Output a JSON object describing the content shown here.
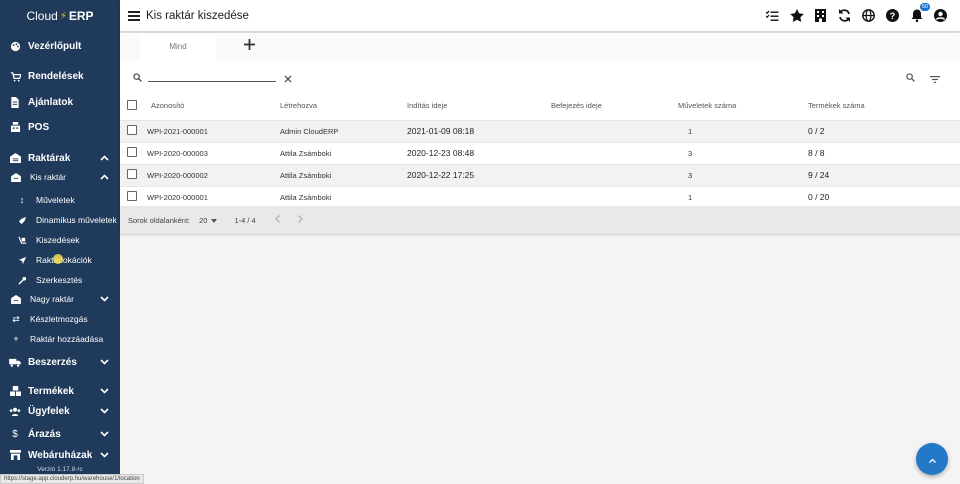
{
  "app": {
    "brand_left": "Cloud",
    "brand_right": "ERP",
    "version": "Verzió 1.17.8-rc"
  },
  "status_url": "https://stage.app.clouderp.hu/warehouse/1/location",
  "sidebar": {
    "dashboard": "Vezérlőpult",
    "orders": "Rendelések",
    "offers": "Ajánlatok",
    "pos": "POS",
    "warehouses": "Raktárak",
    "small_warehouse": "Kis raktár",
    "operations": "Műveletek",
    "dynamic_operations": "Dinamikus műveletek",
    "picking": "Kiszedések",
    "locations": "Raktárlokációk",
    "edit": "Szerkesztés",
    "big_warehouse": "Nagy raktár",
    "stock_movement": "Készletmozgás",
    "add_warehouse": "Raktár hozzáadása",
    "purchasing": "Beszerzés",
    "products": "Termékek",
    "customers": "Ügyfelek",
    "pricing": "Árazás",
    "webshops": "Webáruházak"
  },
  "header": {
    "title": "Kis raktár kiszedése",
    "notifications_count": "50"
  },
  "tabs": {
    "all": "Mind"
  },
  "search": {
    "value": "",
    "placeholder": ""
  },
  "table": {
    "columns": {
      "id": "Azonosító",
      "created_by": "Létrehozva",
      "start": "Indítás ideje",
      "end": "Befejezés ideje",
      "ops": "Műveletek száma",
      "products": "Termékek száma"
    },
    "rows": [
      {
        "id": "WPI-2021-000001",
        "created_by": "Admin CloudERP",
        "start": "2021-01-09 08:18",
        "end": "",
        "ops": "1",
        "products": "0 / 2"
      },
      {
        "id": "WPI-2020-000003",
        "created_by": "Attila Zsámboki",
        "start": "2020-12-23 08:48",
        "end": "",
        "ops": "3",
        "products": "8 / 8"
      },
      {
        "id": "WPI-2020-000002",
        "created_by": "Attila Zsámboki",
        "start": "2020-12-22 17:25",
        "end": "",
        "ops": "3",
        "products": "9 / 24"
      },
      {
        "id": "WPI-2020-000001",
        "created_by": "Attila Zsámboki",
        "start": "",
        "end": "",
        "ops": "1",
        "products": "0 / 20"
      }
    ]
  },
  "pagination": {
    "rows_per_page_label": "Sorok oldalanként:",
    "rows_per_page": "20",
    "range": "1-4 / 4"
  },
  "colors": {
    "sidebar": "#1f3a5a",
    "accent": "#2478c8"
  }
}
